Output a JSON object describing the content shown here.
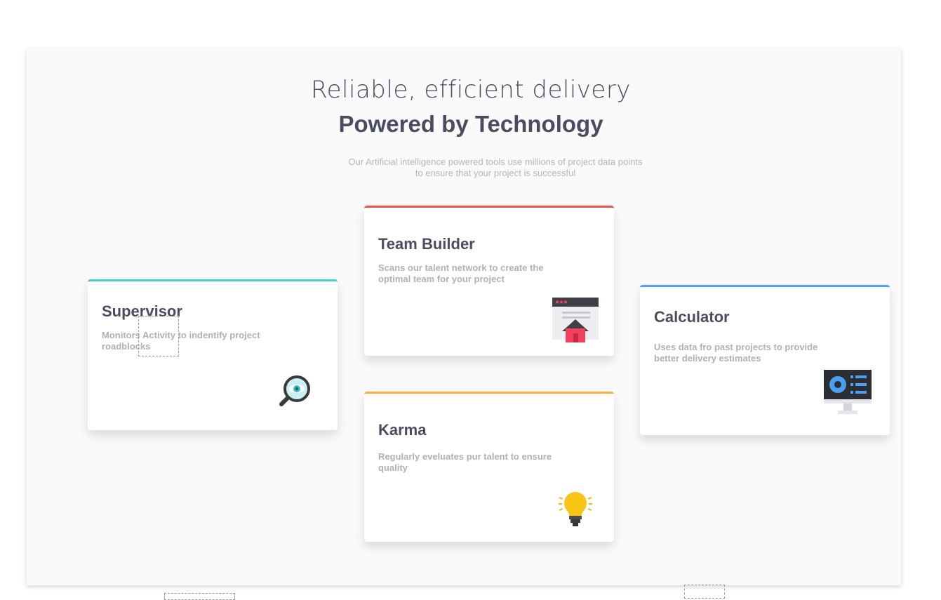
{
  "header": {
    "title_light": "Reliable, efficient delivery",
    "title_bold": "Powered by Technology",
    "subtitle": "Our Artificial intelligence powered tools use millions of project data points to ensure that your project is successful"
  },
  "cards": [
    {
      "title": "Supervisor",
      "description": "Monitors Activity to indentify project roadblocks",
      "icon": "magnifier-eye-icon",
      "accent": "#44d3c2"
    },
    {
      "title": "Team Builder",
      "description": "Scans our talent network to create the optimal team for your project",
      "icon": "browser-house-icon",
      "accent": "#ea5454"
    },
    {
      "title": "Karma",
      "description": "Regularly eveluates pur talent to ensure quality",
      "icon": "lightbulb-icon",
      "accent": "#fcaf41"
    },
    {
      "title": "Calculator",
      "description": "Uses data fro past projects to provide better delivery estimates",
      "icon": "monitor-chart-icon",
      "accent": "#549ef2"
    }
  ],
  "colors": {
    "heading": "#4b4c61",
    "muted_text": "#b1b1b5",
    "background": "#fafafa"
  }
}
